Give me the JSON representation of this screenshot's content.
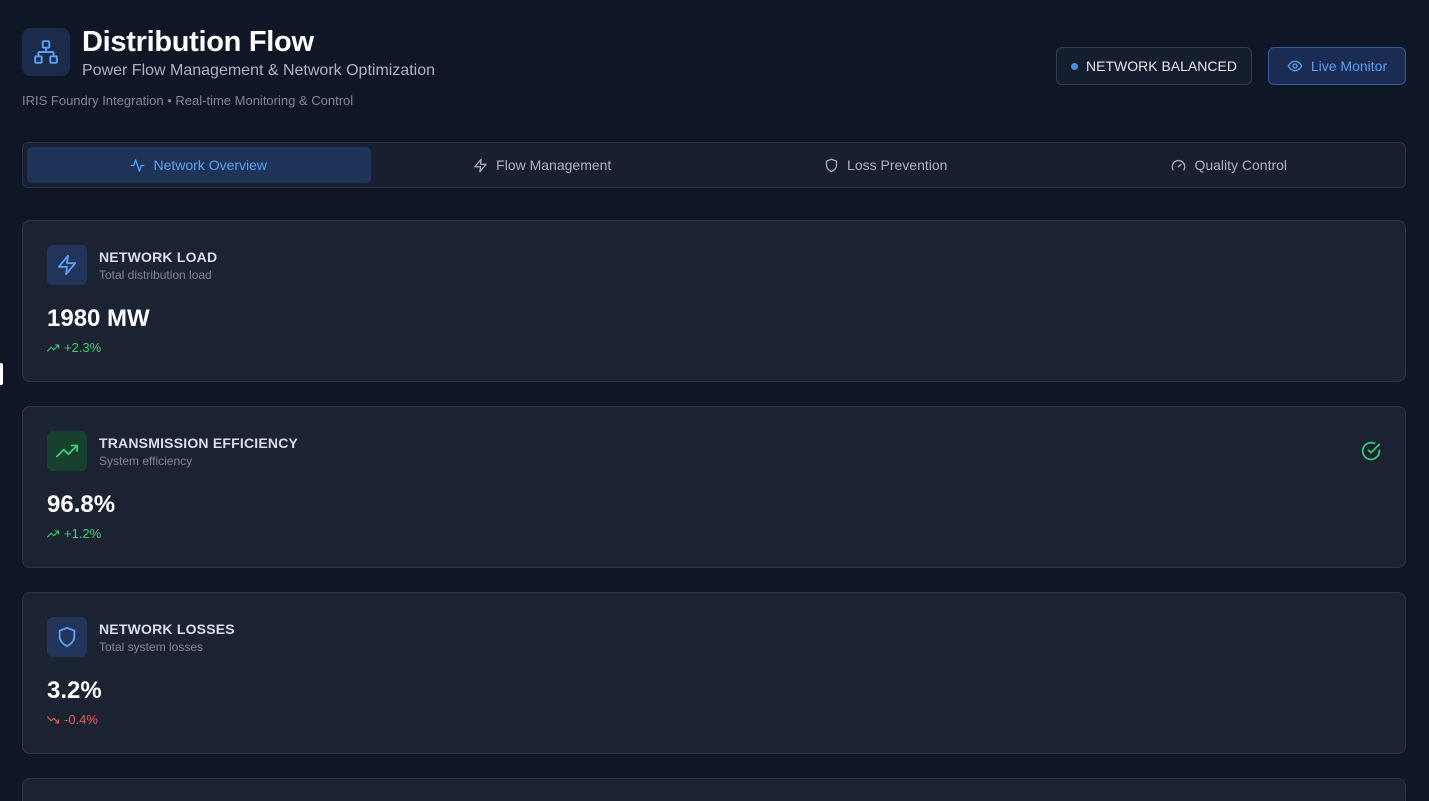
{
  "header": {
    "title": "Distribution Flow",
    "subtitle": "Power Flow Management & Network Optimization",
    "meta": "IRIS Foundry Integration • Real-time Monitoring & Control",
    "status_badge": "NETWORK BALANCED",
    "live_button": "Live Monitor"
  },
  "tabs": [
    {
      "label": "Network Overview",
      "icon": "activity-icon",
      "active": true
    },
    {
      "label": "Flow Management",
      "icon": "zap-icon",
      "active": false
    },
    {
      "label": "Loss Prevention",
      "icon": "shield-icon",
      "active": false
    },
    {
      "label": "Quality Control",
      "icon": "gauge-icon",
      "active": false
    }
  ],
  "cards": [
    {
      "title": "NETWORK LOAD",
      "subtitle": "Total distribution load",
      "value": "1980 MW",
      "change": "+2.3%",
      "trend": "up",
      "icon": "zap-icon"
    },
    {
      "title": "TRANSMISSION EFFICIENCY",
      "subtitle": "System efficiency",
      "value": "96.8%",
      "change": "+1.2%",
      "trend": "up",
      "icon": "trending-up-icon",
      "status_icon": "check-circle-icon"
    },
    {
      "title": "NETWORK LOSSES",
      "subtitle": "Total system losses",
      "value": "3.2%",
      "change": "-0.4%",
      "trend": "down",
      "icon": "shield-icon"
    }
  ],
  "colors": {
    "accent": "#5aa0f5",
    "positive": "#3ecf6e",
    "negative": "#ef5a5a",
    "background": "#0f1626"
  }
}
